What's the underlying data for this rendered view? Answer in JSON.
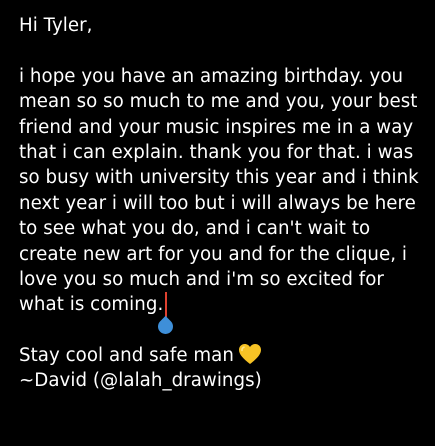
{
  "note": {
    "greeting": "Hi Tyler,",
    "body_lines": [
      "i hope you have an amazing birthday. you",
      "mean so so much to me and you, your best",
      "friend and your music inspires me in a way",
      "that i can explain. thank you for that. i was",
      "so busy with university this year and i think",
      "next year i will too but i will always be here",
      "to see what you do, and i can't wait to",
      "create new art for you and for the clique, i",
      "love you so much and i'm so excited for"
    ],
    "last_body_line": "what is coming.",
    "signoff": "Stay cool and safe man",
    "signoff_icon": "yellow-heart-icon",
    "signature": "~David (@lalah_drawings)"
  },
  "colors": {
    "background": "#000000",
    "text": "#ffffff",
    "cursor": "#e0412f",
    "cursor_handle": "#3e8fd9",
    "heart": "#f7c325"
  }
}
